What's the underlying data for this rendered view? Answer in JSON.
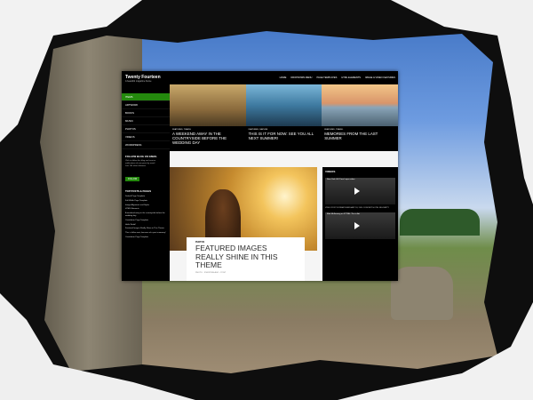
{
  "site": {
    "title": "Twenty Fourteen",
    "description": "A beautiful magazine theme"
  },
  "nav": {
    "links": [
      "HOME",
      "DROPDOWN MENU",
      "PAGE TEMPLATES",
      "HTML ELEMENTS",
      "IMAGE & VIDEO FEATURES"
    ]
  },
  "sidebar": {
    "menu": [
      "ITEMS",
      "ARTWORK",
      "BOOKS",
      "MUSIC",
      "PHOTOS",
      "VIDEOS",
      "WORDPRESS"
    ],
    "follow": {
      "title": "FOLLOW BLOG VIA EMAIL",
      "text": "Click to follow this blog and receive notifications of new posts by email.",
      "count": "Join 154 other followers",
      "button": "FOLLOW"
    },
    "top_posts": {
      "title": "TOP POSTS & PAGES",
      "items": [
        "Default Page Template",
        "Full Width Page Template",
        "Image Alignment and Styles",
        "HTML Elements",
        "A weekend away in the countryside before the wedding day",
        "Contributor Page Template",
        "Hello World!",
        "Featured Images Really Shine in This Theme",
        "This is fallen next, because of a post summary!",
        "Contributor Page Template"
      ]
    }
  },
  "featured": [
    {
      "category": "FEATURED, TRAVEL",
      "title": "A WEEKEND AWAY IN THE COUNTRYSIDE BEFORE THE WEDDING DAY"
    },
    {
      "category": "FEATURED, NATURE",
      "title": "THIS IS IT FOR NOW: SEE YOU ALL NEXT SUMMER!"
    },
    {
      "category": "FEATURED, TRAVEL",
      "title": "MEMORIES FROM THE LAST SUMMER"
    }
  ],
  "main_post": {
    "category": "PHOTOS",
    "title": "FEATURED IMAGES REALLY SHINE IN THIS THEME",
    "meta": [
      "PHOTO",
      "3 MONTHS AGO",
      "POST"
    ]
  },
  "videos": {
    "heading": "VIDEOS",
    "items": [
      {
        "title": "New York: HD Time Lapse video",
        "caption": "VIDEO POST FORMAT FEBRUARY 18, 2014 CONCERT HOTEL BIG.PARTY"
      },
      {
        "title": "Matt Mullenweg on KTTBH: This is Art",
        "caption": ""
      }
    ]
  },
  "colors": {
    "accent": "#24890d",
    "dark": "#000000"
  }
}
